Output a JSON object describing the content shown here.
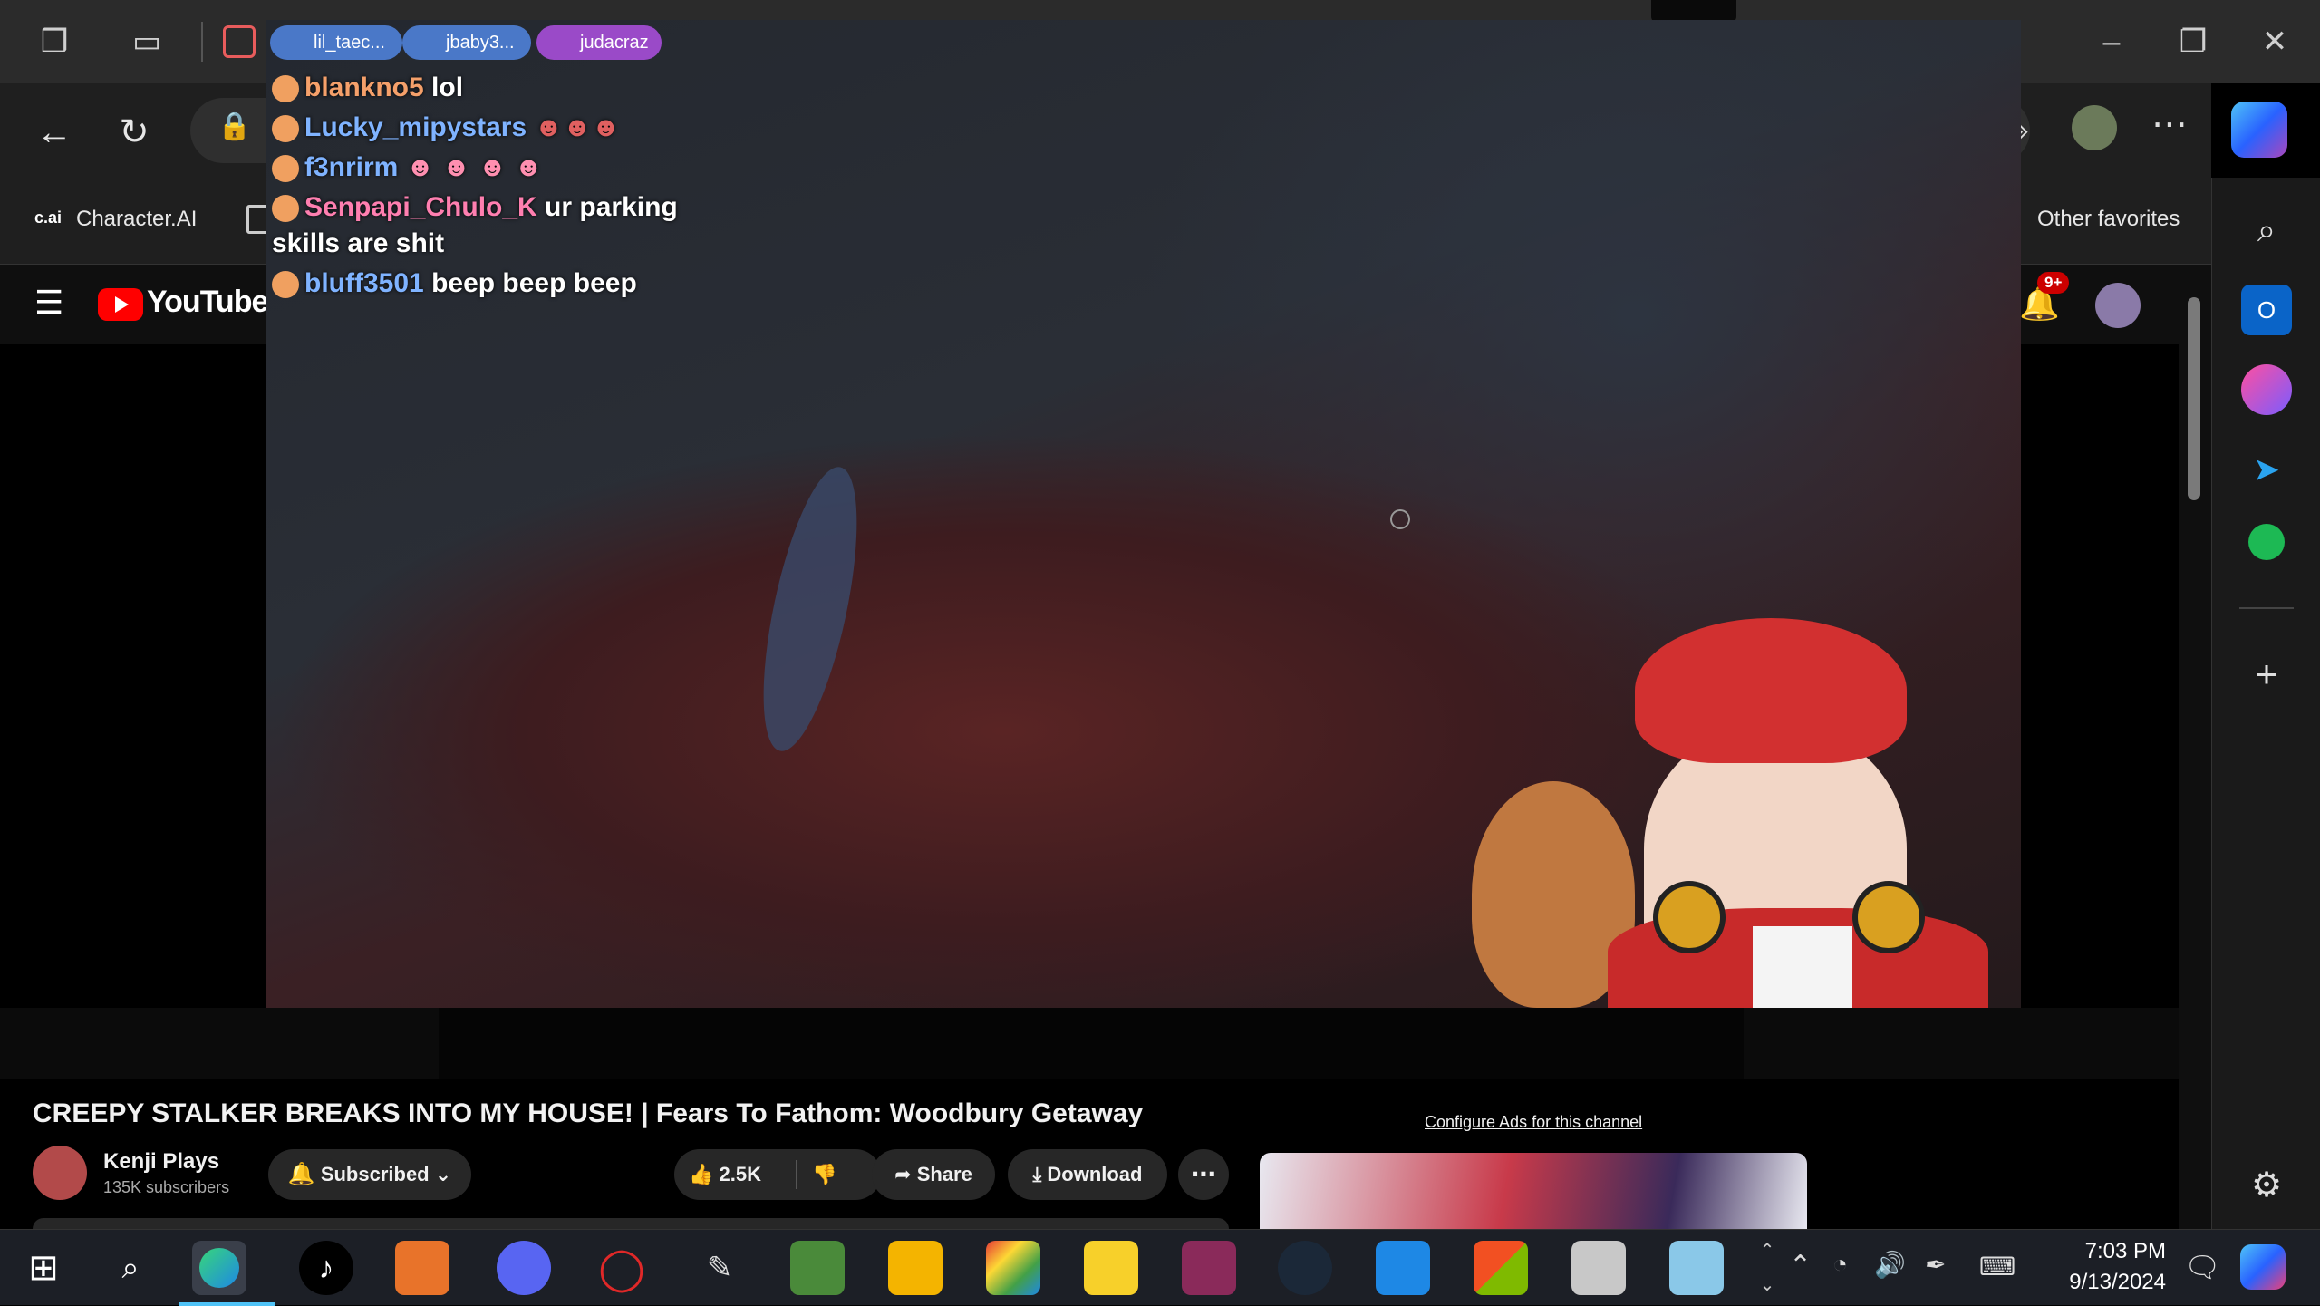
{
  "browser": {
    "favorites": {
      "character_ai": "Character.AI",
      "cai_badge": "c.ai",
      "other": "Other favorites"
    }
  },
  "youtube": {
    "logo_text": "YouTube",
    "notif_badge": "9+",
    "video_title": "CREEPY STALKER BREAKS INTO MY HOUSE! | Fears To Fathom: Woodbury Getaway",
    "channel_name": "Kenji Plays",
    "subscribers": "135K subscribers",
    "subscribed_label": "Subscribed",
    "likes": "2.5K",
    "share_label": "Share",
    "download_label": "Download",
    "ads_label": "Configure Ads for this channel"
  },
  "stream_chat": {
    "pills": [
      "lil_taec...",
      "jbaby3...",
      "judacraz"
    ],
    "messages": [
      {
        "user": "blankno5",
        "text": "lol",
        "color": "#f5a06a"
      },
      {
        "user": "Lucky_mipystars",
        "text": "",
        "color": "#7fb3ff"
      },
      {
        "user": "f3nrirm",
        "text": "",
        "color": "#7fb3ff"
      },
      {
        "user": "Senpapi_Chulo_K",
        "text": "ur parking",
        "color": "#ff7fb0"
      },
      {
        "user": "",
        "text": "skills are shit",
        "color": "#ffffff"
      },
      {
        "user": "bluff3501",
        "text": "beep beep beep",
        "color": "#7fb3ff"
      }
    ]
  },
  "taskbar": {
    "time": "7:03 PM",
    "date": "9/13/2024"
  },
  "colors": {
    "yt_red": "#ff0000",
    "accent": "#0078d4"
  }
}
